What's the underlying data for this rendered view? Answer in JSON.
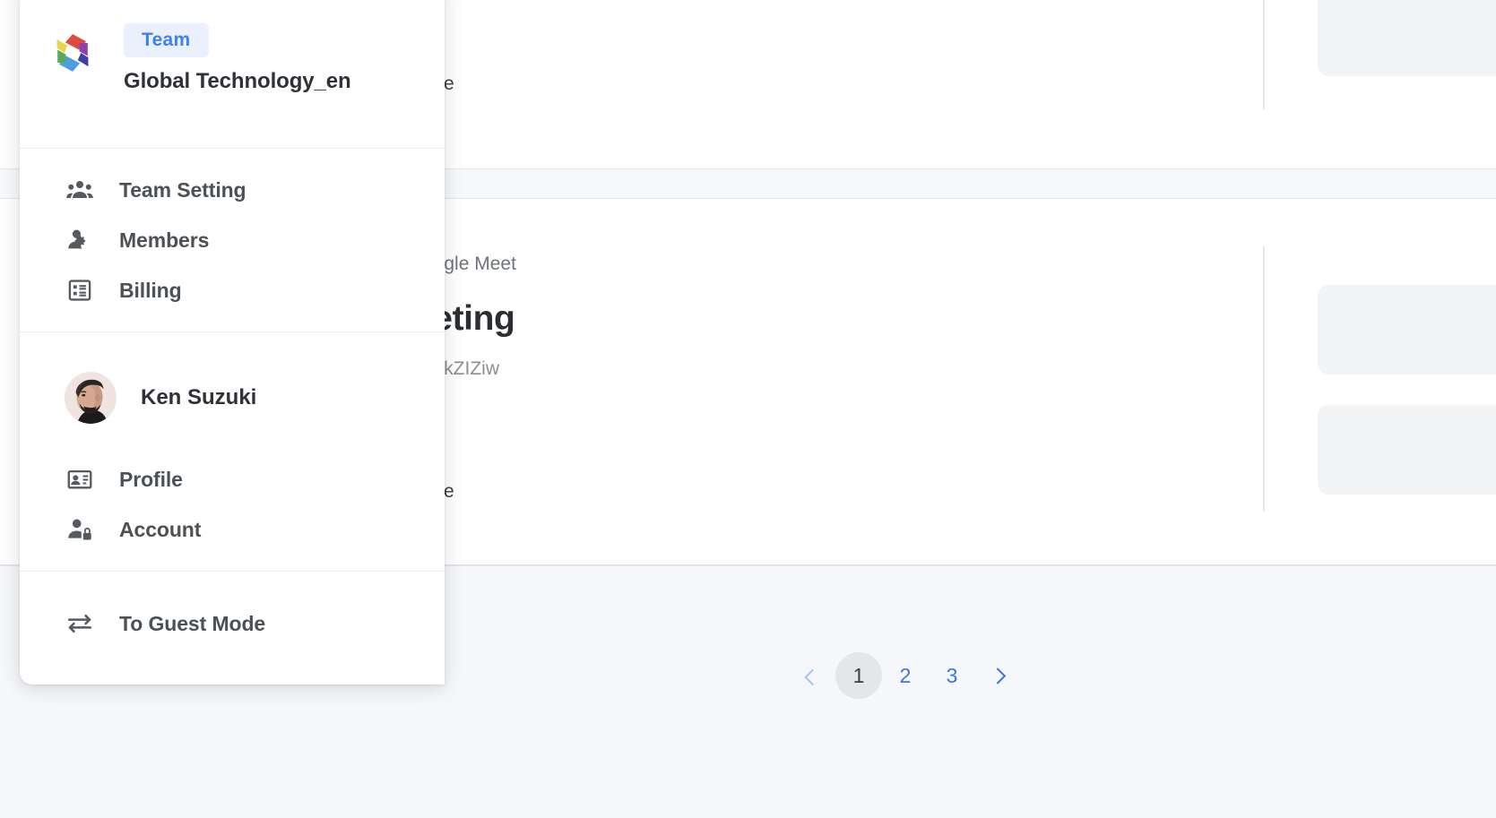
{
  "theme": {
    "accent_blue": "#4080f0",
    "link_blue": "#3f73e3",
    "badge_bg": "#eaf1fd",
    "panel_bg": "#ffffff",
    "page_bg": "#f5f7fa",
    "text_dark": "#2e3236",
    "text_muted": "#6f7479",
    "divider": "#e8eaed"
  },
  "menu": {
    "team": {
      "badge_label": "Team",
      "name": "Global Technology_en",
      "logo_icon": "hexagon-pinwheel-logo"
    },
    "team_items": [
      {
        "label": "Team Setting",
        "icon": "people-group-icon",
        "name": "team-setting"
      },
      {
        "label": "Members",
        "icon": "person-gear-icon",
        "name": "members"
      },
      {
        "label": "Billing",
        "icon": "receipt-list-icon",
        "name": "billing"
      }
    ],
    "user": {
      "name": "Ken Suzuki",
      "avatar_icon": "user-photo-avatar"
    },
    "user_items": [
      {
        "label": "Profile",
        "icon": "contact-card-icon",
        "name": "profile"
      },
      {
        "label": "Account",
        "icon": "person-lock-icon",
        "name": "account"
      }
    ],
    "footer_items": [
      {
        "label": "To Guest Mode",
        "icon": "swap-horizontal-icon",
        "name": "to-guest-mode"
      }
    ]
  },
  "background": {
    "fragment_top_right": "e",
    "fragment_provider": "oogle Meet",
    "fragment_title": "eeting",
    "fragment_id": "RkZIZiw",
    "fragment_bottom_left": "e"
  },
  "pagination": {
    "prev_icon": "chevron-left-icon",
    "next_icon": "chevron-right-icon",
    "pages": [
      "1",
      "2",
      "3"
    ],
    "current_page": "1"
  }
}
